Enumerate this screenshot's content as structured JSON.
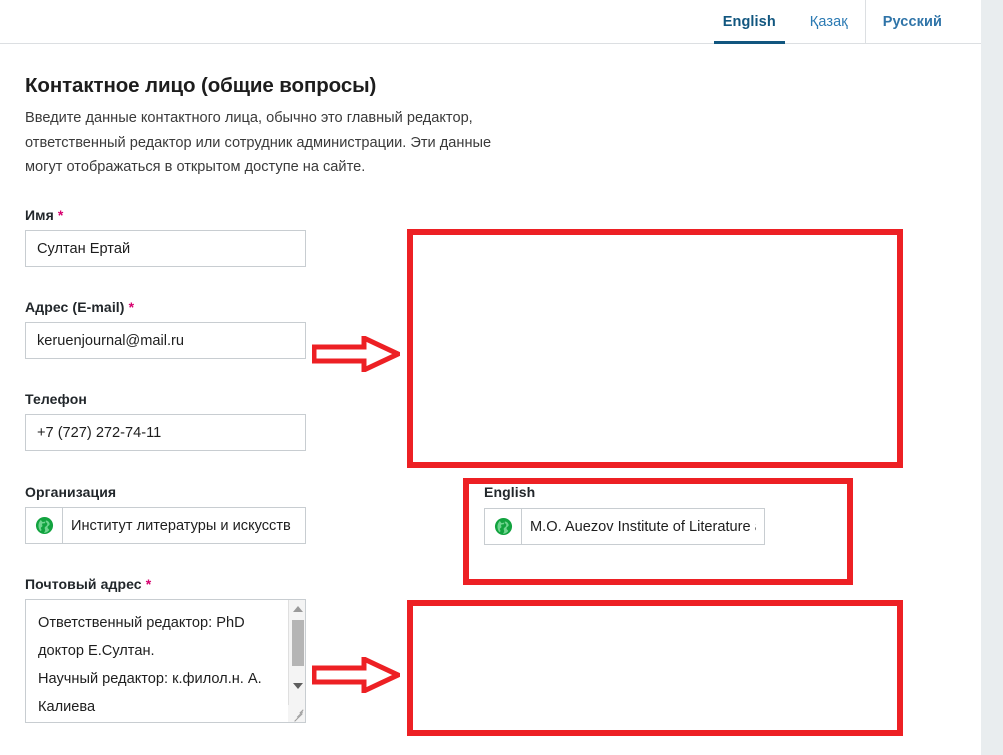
{
  "language_tabs": {
    "items": [
      {
        "label": "English",
        "active": true,
        "style": "active"
      },
      {
        "label": "Қазақ",
        "active": false,
        "style": "normal"
      },
      {
        "label": "Русский",
        "active": false,
        "style": "bold"
      }
    ]
  },
  "page": {
    "title": "Контактное лицо (общие вопросы)",
    "description": "Введите данные контактного лица, обычно это главный редактор, ответственный редактор или сотрудник администрации. Эти данные могут отображаться в открытом доступе на сайте."
  },
  "form": {
    "name": {
      "label": "Имя",
      "required_mark": "*",
      "value": "Султан Ертай",
      "placeholder": ""
    },
    "email": {
      "label": "Адрес (E-mail)",
      "required_mark": "*",
      "value": "keruenjournal@mail.ru",
      "placeholder": ""
    },
    "phone": {
      "label": "Телефон",
      "required_mark": "",
      "value": "+7 (727) 272-74-11",
      "placeholder": ""
    },
    "organization": {
      "label": "Организация",
      "required_mark": "",
      "value": "Институт литературы и искусств",
      "placeholder": "",
      "icon": "globe-icon"
    },
    "postal_address": {
      "label": "Почтовый адрес",
      "required_mark": "*",
      "value": "Ответственный редактор: PhD доктор Е.Султан.\nНаучный редактор: к.филол.н. А. Калиева",
      "placeholder": ""
    }
  },
  "english_section": {
    "label": "English",
    "organization": {
      "value": "M.O. Auezov Institute of Literature and Art",
      "placeholder": "",
      "icon": "globe-icon"
    }
  },
  "colors": {
    "annotation_red": "#ed2024",
    "active_tab": "#11567f",
    "inactive_tab": "#2b7ab3",
    "required_asterisk": "#d6006e",
    "globe_green": "#12a33f",
    "input_border": "#c8cdd1",
    "scroll_gutter": "#e9edef"
  }
}
